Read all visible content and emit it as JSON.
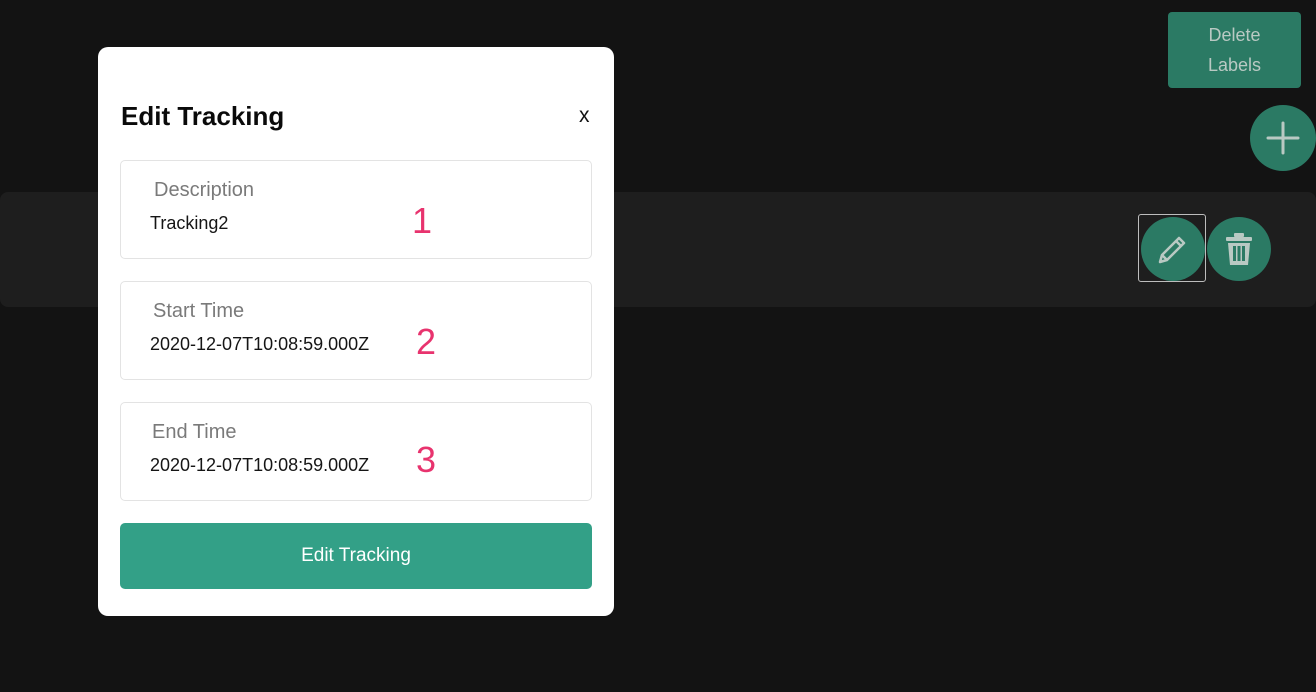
{
  "toolbar": {
    "delete_labels_label": "Delete\nLabels"
  },
  "modal": {
    "title": "Edit Tracking",
    "close_label": "x",
    "fields": [
      {
        "label": "Description",
        "value": "Tracking2",
        "annotation": "1"
      },
      {
        "label": "Start Time",
        "value": "2020-12-07T10:08:59.000Z",
        "annotation": "2"
      },
      {
        "label": "End Time",
        "value": "2020-12-07T10:08:59.000Z",
        "annotation": "3"
      }
    ],
    "submit_label": "Edit Tracking"
  },
  "icons": {
    "add": "plus-icon",
    "edit": "pencil-icon",
    "delete": "trash-icon"
  },
  "colors": {
    "background": "#131313",
    "accent": "#2b7a64",
    "button": "#33a087",
    "annotation": "#e8336e"
  }
}
